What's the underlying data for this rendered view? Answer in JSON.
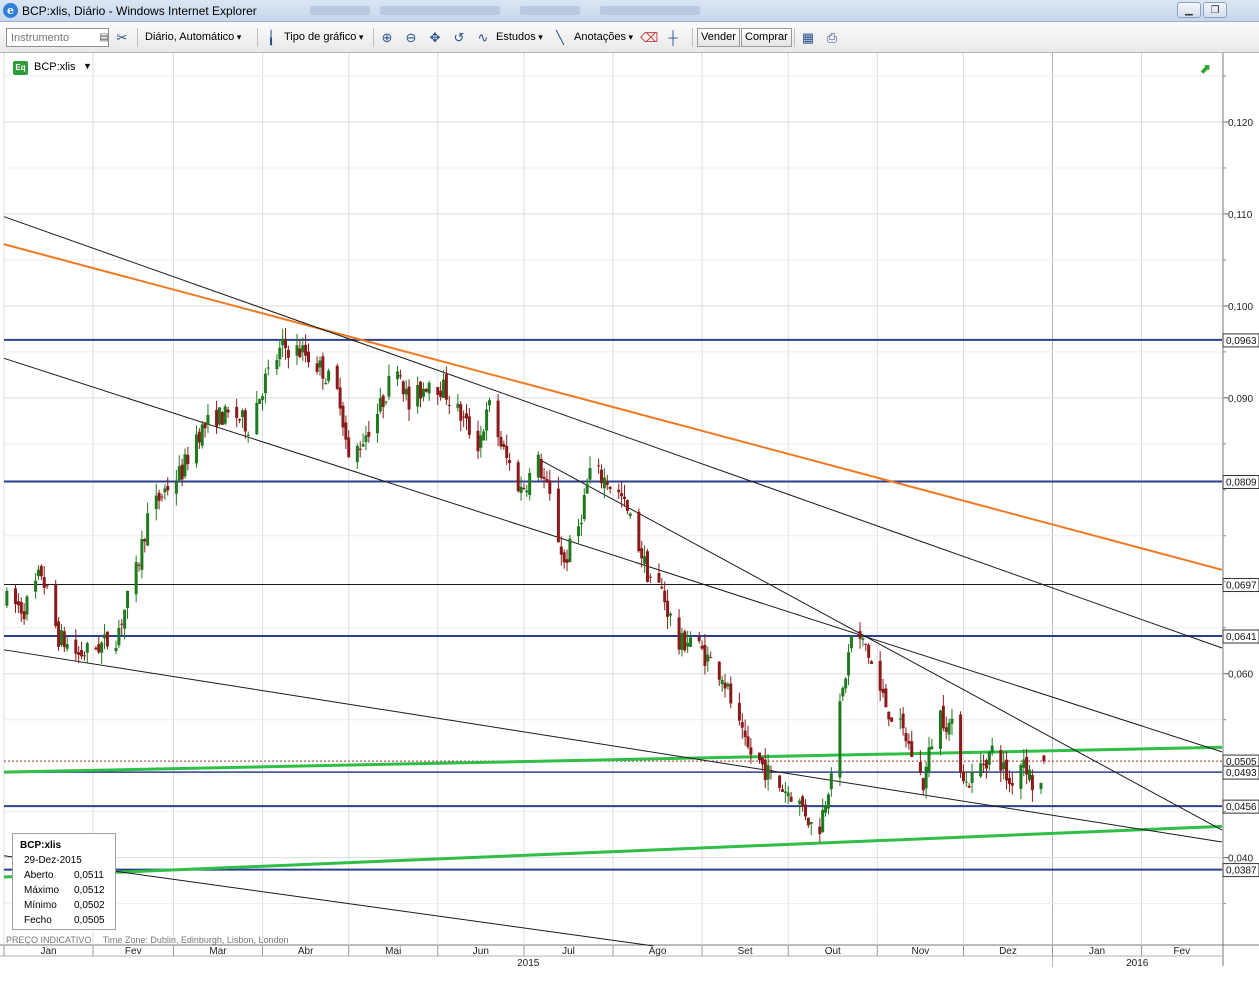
{
  "window": {
    "title": "BCP:xlis, Diário - Windows Internet Explorer",
    "minimize_icon": "minimize-icon",
    "restore_icon": "restore-icon"
  },
  "toolbar": {
    "instrument_placeholder": "Instrumento",
    "interval_label": "Diário,  Automático",
    "chart_type_label": "Tipo de gráfico",
    "studies_label": "Estudos",
    "annotations_label": "Anotações",
    "sell_label": "Vender",
    "buy_label": "Comprar"
  },
  "chart_header": {
    "symbol": "BCP:xlis",
    "badge": "Eq"
  },
  "info_box": {
    "symbol": "BCP:xlis",
    "date": "29-Dez-2015",
    "rows": [
      {
        "label": "Aberto",
        "value": "0,0511"
      },
      {
        "label": "Máximo",
        "value": "0,0512"
      },
      {
        "label": "Mínimo",
        "value": "0,0502"
      },
      {
        "label": "Fecho",
        "value": "0,0505"
      }
    ]
  },
  "footer": {
    "note": "PREÇO INDICATIVO",
    "timezone": "Time Zone: Dublin, Edinburgh, Lisbon, London"
  },
  "colors": {
    "candle_up": "#1f7a1f",
    "candle_down": "#8b1a1a",
    "level_line": "#2b3f8c",
    "trend_orange": "#f07a22",
    "trend_green": "#2fbf47",
    "trend_black": "#1a1a1a",
    "grid": "#dddddd"
  },
  "chart_data": {
    "type": "candlestick",
    "y_axis": {
      "ylim": [
        0.0305,
        0.1275
      ],
      "ticks": [
        {
          "v": 0.12,
          "label": "0,120"
        },
        {
          "v": 0.11,
          "label": "0,110"
        },
        {
          "v": 0.1,
          "label": "0,100"
        },
        {
          "v": 0.09,
          "label": "0,090"
        },
        {
          "v": 0.06,
          "label": "0,060"
        },
        {
          "v": 0.04,
          "label": "0,040"
        }
      ],
      "highlight_labels": [
        {
          "v": 0.0963,
          "label": "0,0963"
        },
        {
          "v": 0.0809,
          "label": "0,0809"
        },
        {
          "v": 0.0697,
          "label": "0,0697"
        },
        {
          "v": 0.0641,
          "label": "0,0641"
        },
        {
          "v": 0.0505,
          "label": "0,0505"
        },
        {
          "v": 0.0493,
          "label": "0,0493"
        },
        {
          "v": 0.0456,
          "label": "0,0456"
        },
        {
          "v": 0.0387,
          "label": "0,0387"
        }
      ]
    },
    "x_axis": {
      "range": [
        "2015-01-01",
        "2016-02-29"
      ],
      "months": [
        {
          "date": "2015-01-01",
          "label": "Jan"
        },
        {
          "date": "2015-02-01",
          "label": "Fev"
        },
        {
          "date": "2015-03-01",
          "label": "Mar"
        },
        {
          "date": "2015-04-01",
          "label": "Abr"
        },
        {
          "date": "2015-05-01",
          "label": "Mai"
        },
        {
          "date": "2015-06-01",
          "label": "Jun"
        },
        {
          "date": "2015-07-01",
          "label": "Jul"
        },
        {
          "date": "2015-08-01",
          "label": "Ago"
        },
        {
          "date": "2015-09-01",
          "label": "Set"
        },
        {
          "date": "2015-10-01",
          "label": "Out"
        },
        {
          "date": "2015-11-01",
          "label": "Nov"
        },
        {
          "date": "2015-12-01",
          "label": "Dez"
        },
        {
          "date": "2016-01-01",
          "label": "Jan"
        },
        {
          "date": "2016-02-01",
          "label": "Fev"
        }
      ],
      "years": [
        {
          "date": "2015-01-01",
          "end": "2016-01-01",
          "label": "2015"
        },
        {
          "date": "2016-01-01",
          "end": "2016-03-01",
          "label": "2016"
        }
      ]
    },
    "horizontal_levels": [
      {
        "v": 0.0963,
        "color": "#2b3f8c",
        "width": 2
      },
      {
        "v": 0.0809,
        "color": "#2b3f8c",
        "width": 2
      },
      {
        "v": 0.0697,
        "color": "#1a1a1a",
        "width": 1
      },
      {
        "v": 0.0641,
        "color": "#2b3f8c",
        "width": 2
      },
      {
        "v": 0.0505,
        "color": "#a03030",
        "width": 1,
        "dash": "2,2"
      },
      {
        "v": 0.0493,
        "color": "#2b3f8c",
        "width": 1.5
      },
      {
        "v": 0.0456,
        "color": "#2b3f8c",
        "width": 2
      },
      {
        "v": 0.0387,
        "color": "#2b3f8c",
        "width": 2
      }
    ],
    "trend_lines": [
      {
        "from": [
          "2015-01-01",
          0.1067
        ],
        "to": [
          "2016-02-29",
          0.0713
        ],
        "color": "#f07a22",
        "width": 2
      },
      {
        "from": [
          "2015-01-01",
          0.0493
        ],
        "to": [
          "2016-02-29",
          0.052
        ],
        "color": "#2fbf47",
        "width": 3
      },
      {
        "from": [
          "2015-01-01",
          0.0379
        ],
        "to": [
          "2016-02-29",
          0.0434
        ],
        "color": "#2fbf47",
        "width": 3
      },
      {
        "from": [
          "2015-01-01",
          0.1097
        ],
        "to": [
          "2016-02-29",
          0.0628
        ],
        "color": "#1a1a1a",
        "width": 1
      },
      {
        "from": [
          "2015-01-01",
          0.0943
        ],
        "to": [
          "2016-02-29",
          0.0515
        ],
        "color": "#1a1a1a",
        "width": 1
      },
      {
        "from": [
          "2015-01-01",
          0.0626
        ],
        "to": [
          "2016-02-29",
          0.0417
        ],
        "color": "#1a1a1a",
        "width": 1
      },
      {
        "from": [
          "2015-01-01",
          0.0402
        ],
        "to": [
          "2015-08-15",
          0.0304
        ],
        "color": "#1a1a1a",
        "width": 1
      },
      {
        "from": [
          "2015-07-07",
          0.0832
        ],
        "to": [
          "2016-02-29",
          0.043
        ],
        "color": "#1a1a1a",
        "width": 1
      }
    ],
    "anchors": [
      [
        "2015-01-02",
        0.068
      ],
      [
        "2015-01-08",
        0.067
      ],
      [
        "2015-01-14",
        0.071
      ],
      [
        "2015-01-20",
        0.064
      ],
      [
        "2015-01-27",
        0.062
      ],
      [
        "2015-02-03",
        0.063
      ],
      [
        "2015-02-09",
        0.064
      ],
      [
        "2015-02-16",
        0.071
      ],
      [
        "2015-02-20",
        0.077
      ],
      [
        "2015-02-26",
        0.08
      ],
      [
        "2015-03-04",
        0.082
      ],
      [
        "2015-03-09",
        0.086
      ],
      [
        "2015-03-16",
        0.088
      ],
      [
        "2015-03-23",
        0.088
      ],
      [
        "2015-03-27",
        0.087
      ],
      [
        "2015-04-02",
        0.092
      ],
      [
        "2015-04-08",
        0.0955
      ],
      [
        "2015-04-15",
        0.095
      ],
      [
        "2015-04-22",
        0.093
      ],
      [
        "2015-04-28",
        0.09
      ],
      [
        "2015-05-01",
        0.083
      ],
      [
        "2015-05-05",
        0.085
      ],
      [
        "2015-05-12",
        0.089
      ],
      [
        "2015-05-18",
        0.094
      ],
      [
        "2015-05-22",
        0.089
      ],
      [
        "2015-05-29",
        0.092
      ],
      [
        "2015-06-03",
        0.091
      ],
      [
        "2015-06-09",
        0.088
      ],
      [
        "2015-06-15",
        0.085
      ],
      [
        "2015-06-19",
        0.089
      ],
      [
        "2015-06-24",
        0.084
      ],
      [
        "2015-06-30",
        0.08
      ],
      [
        "2015-07-06",
        0.083
      ],
      [
        "2015-07-10",
        0.079
      ],
      [
        "2015-07-15",
        0.072
      ],
      [
        "2015-07-20",
        0.076
      ],
      [
        "2015-07-24",
        0.082
      ],
      [
        "2015-07-30",
        0.081
      ],
      [
        "2015-08-04",
        0.079
      ],
      [
        "2015-08-09",
        0.075
      ],
      [
        "2015-08-13",
        0.071
      ],
      [
        "2015-08-18",
        0.069
      ],
      [
        "2015-08-24",
        0.063
      ],
      [
        "2015-08-28",
        0.064
      ],
      [
        "2015-09-02",
        0.062
      ],
      [
        "2015-09-08",
        0.06
      ],
      [
        "2015-09-12",
        0.056
      ],
      [
        "2015-09-16",
        0.052
      ],
      [
        "2015-09-22",
        0.05
      ],
      [
        "2015-09-27",
        0.048
      ],
      [
        "2015-10-02",
        0.047
      ],
      [
        "2015-10-07",
        0.045
      ],
      [
        "2015-10-11",
        0.042
      ],
      [
        "2015-10-15",
        0.048
      ],
      [
        "2015-10-20",
        0.058
      ],
      [
        "2015-10-23",
        0.064
      ],
      [
        "2015-10-28",
        0.063
      ],
      [
        "2015-11-02",
        0.058
      ],
      [
        "2015-11-05",
        0.056
      ],
      [
        "2015-11-11",
        0.053
      ],
      [
        "2015-11-17",
        0.048
      ],
      [
        "2015-11-22",
        0.056
      ],
      [
        "2015-11-27",
        0.054
      ],
      [
        "2015-12-02",
        0.048
      ],
      [
        "2015-12-07",
        0.05
      ],
      [
        "2015-12-12",
        0.052
      ],
      [
        "2015-12-17",
        0.048
      ],
      [
        "2015-12-22",
        0.051
      ],
      [
        "2015-12-26",
        0.047
      ],
      [
        "2015-12-31",
        0.049
      ],
      [
        "2016-01-06",
        0.052
      ],
      [
        "2016-01-12",
        0.052
      ],
      [
        "2016-01-19",
        0.051
      ],
      [
        "2016-01-28",
        0.0505
      ]
    ],
    "last_candle": {
      "date": "2015-12-29",
      "open": 0.0511,
      "high": 0.0512,
      "low": 0.0502,
      "close": 0.0505
    }
  }
}
